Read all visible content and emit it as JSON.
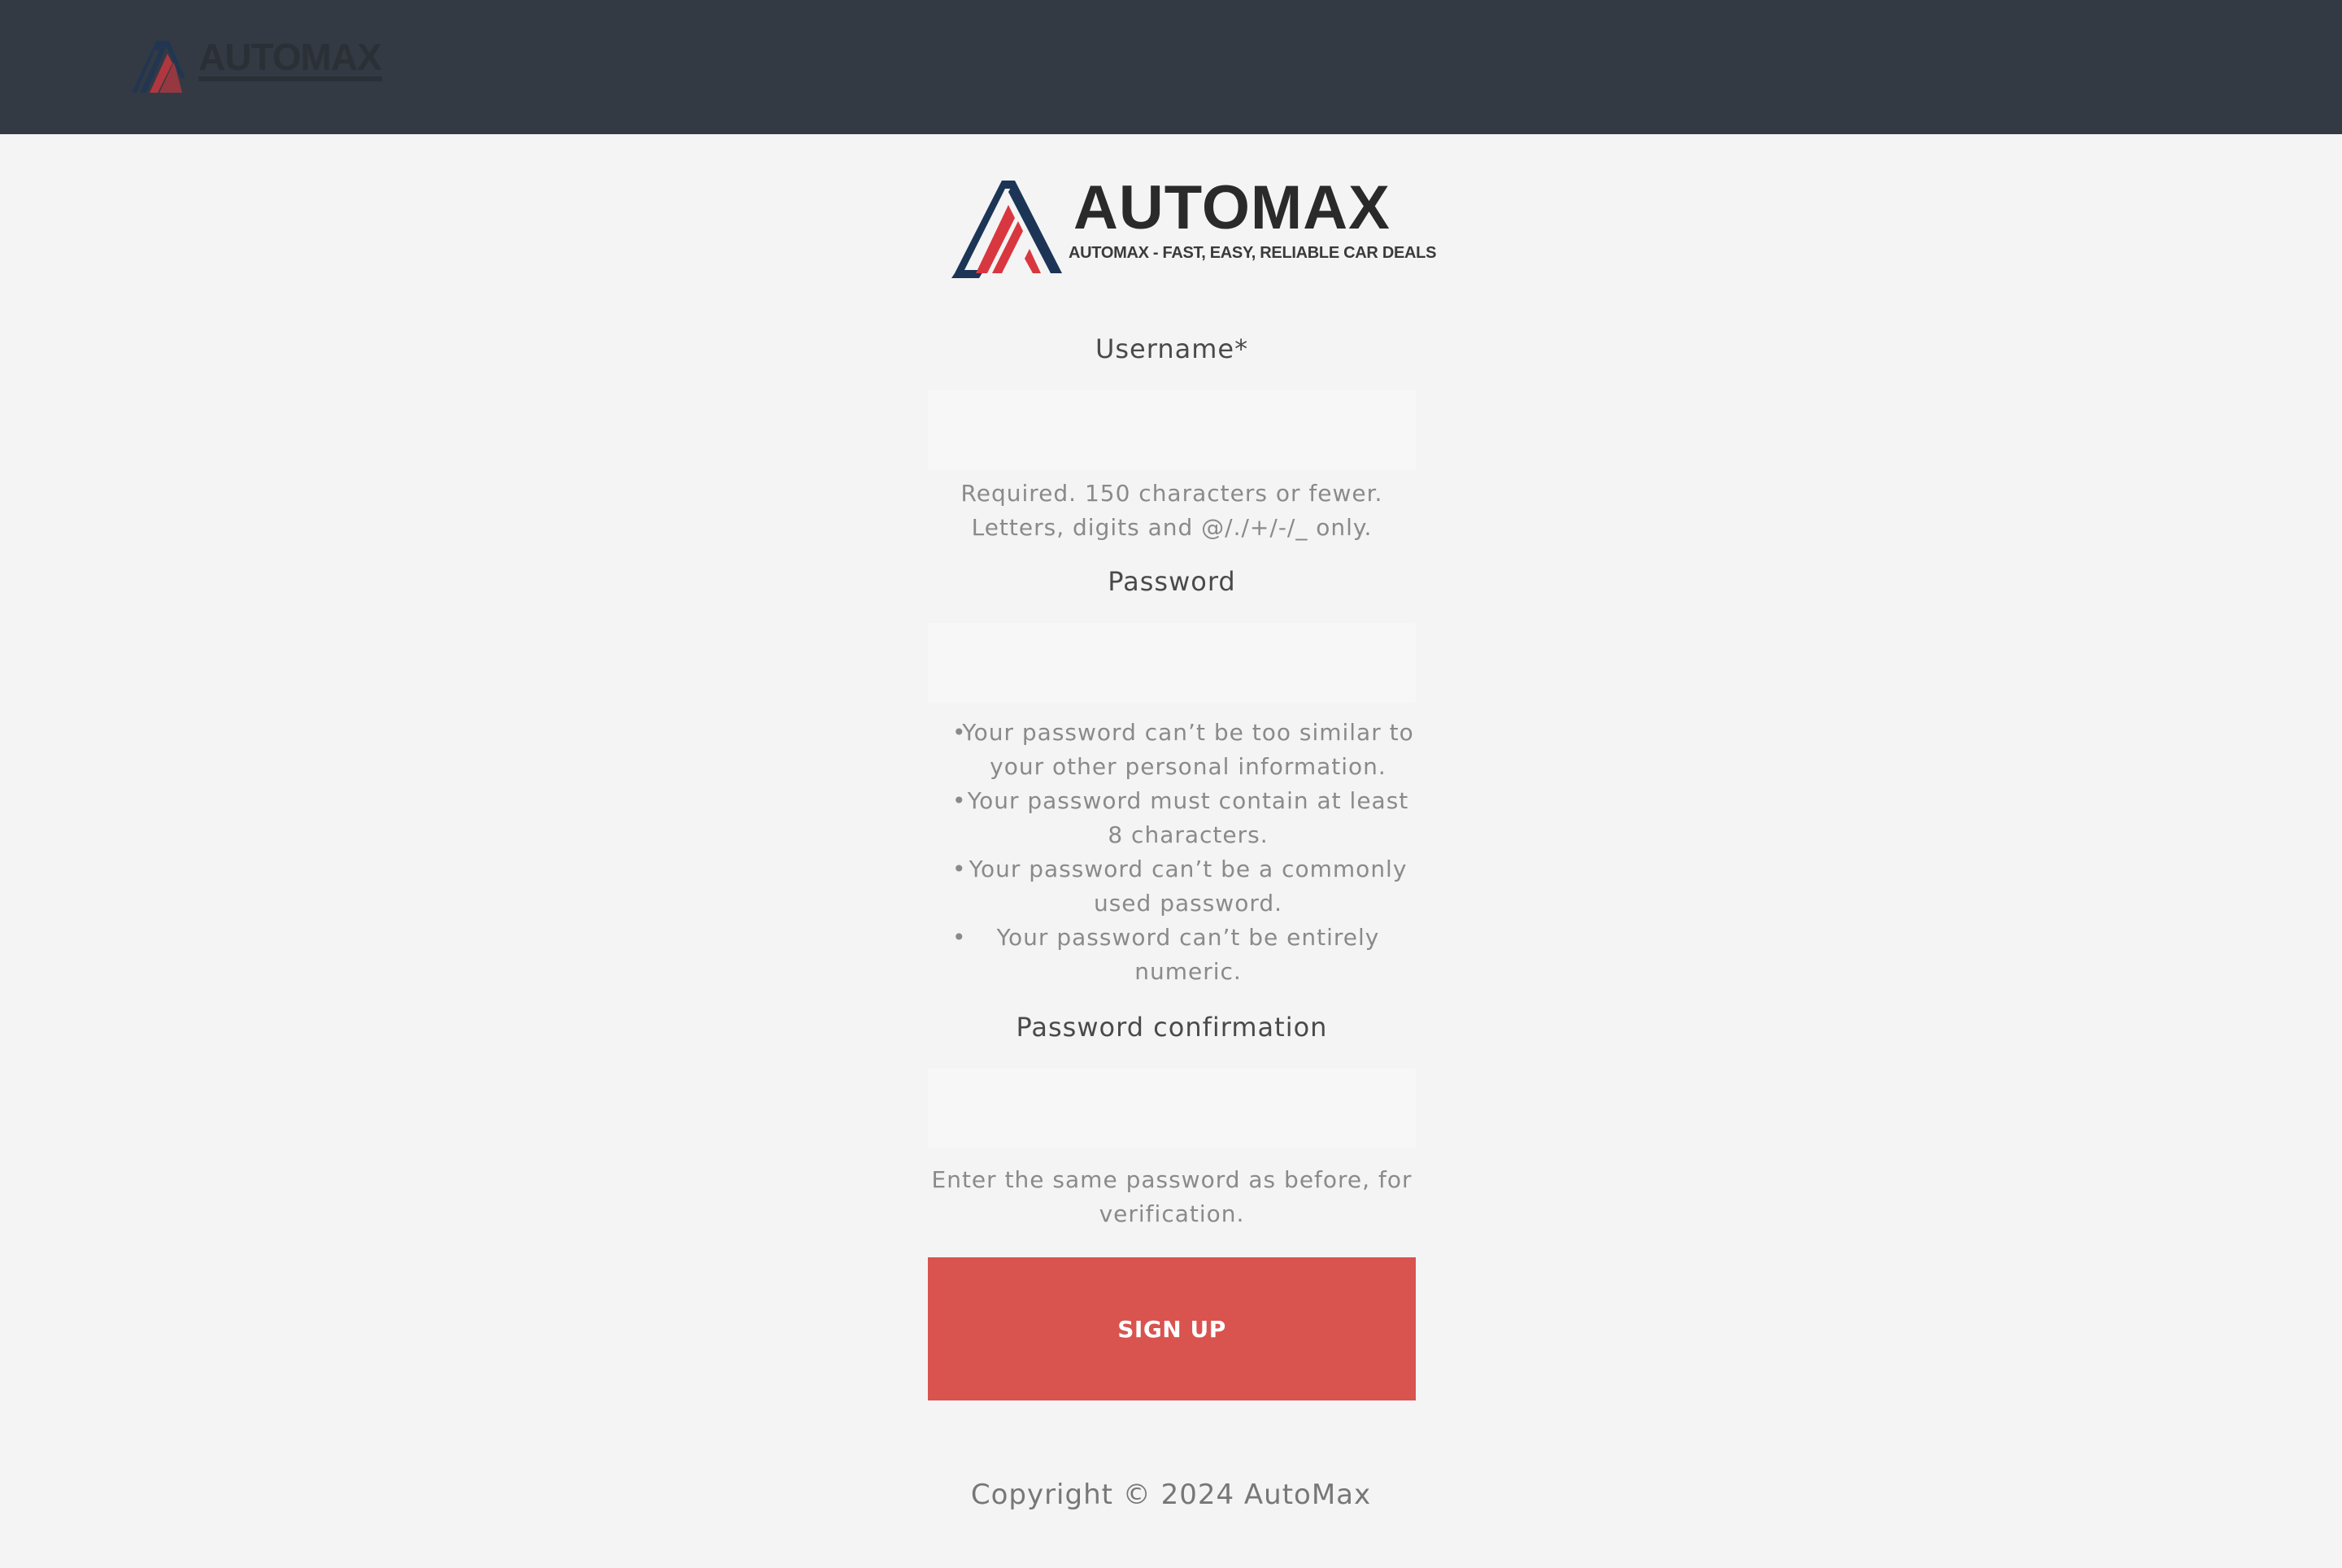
{
  "brand": {
    "name": "AUTOMAX",
    "tagline": "AUTOMAX - FAST, EASY, RELIABLE CAR DEALS",
    "colors": {
      "navy": "#1c3557",
      "red": "#d9373f",
      "dark": "#333333"
    }
  },
  "form": {
    "username_label": "Username*",
    "username_value": "",
    "username_help_line1": "Required. 150 characters or fewer.",
    "username_help_line2": "Letters, digits and @/./+/-/_ only.",
    "password_label": "Password",
    "password_value": "",
    "password_rules": [
      "Your password can’t be too similar to your other personal information.",
      "Your password must contain at least 8 characters.",
      "Your password can’t be a commonly used password.",
      "Your password can’t be entirely numeric."
    ],
    "confirm_label": "Password confirmation",
    "confirm_value": "",
    "confirm_help": "Enter the same password as before, for verification.",
    "submit_label": "SIGN UP"
  },
  "footer": {
    "copyright": "Copyright © 2024 AutoMax"
  },
  "colors": {
    "topbar": "#343a43",
    "background": "#f4f4f4",
    "button": "#d9534f"
  }
}
